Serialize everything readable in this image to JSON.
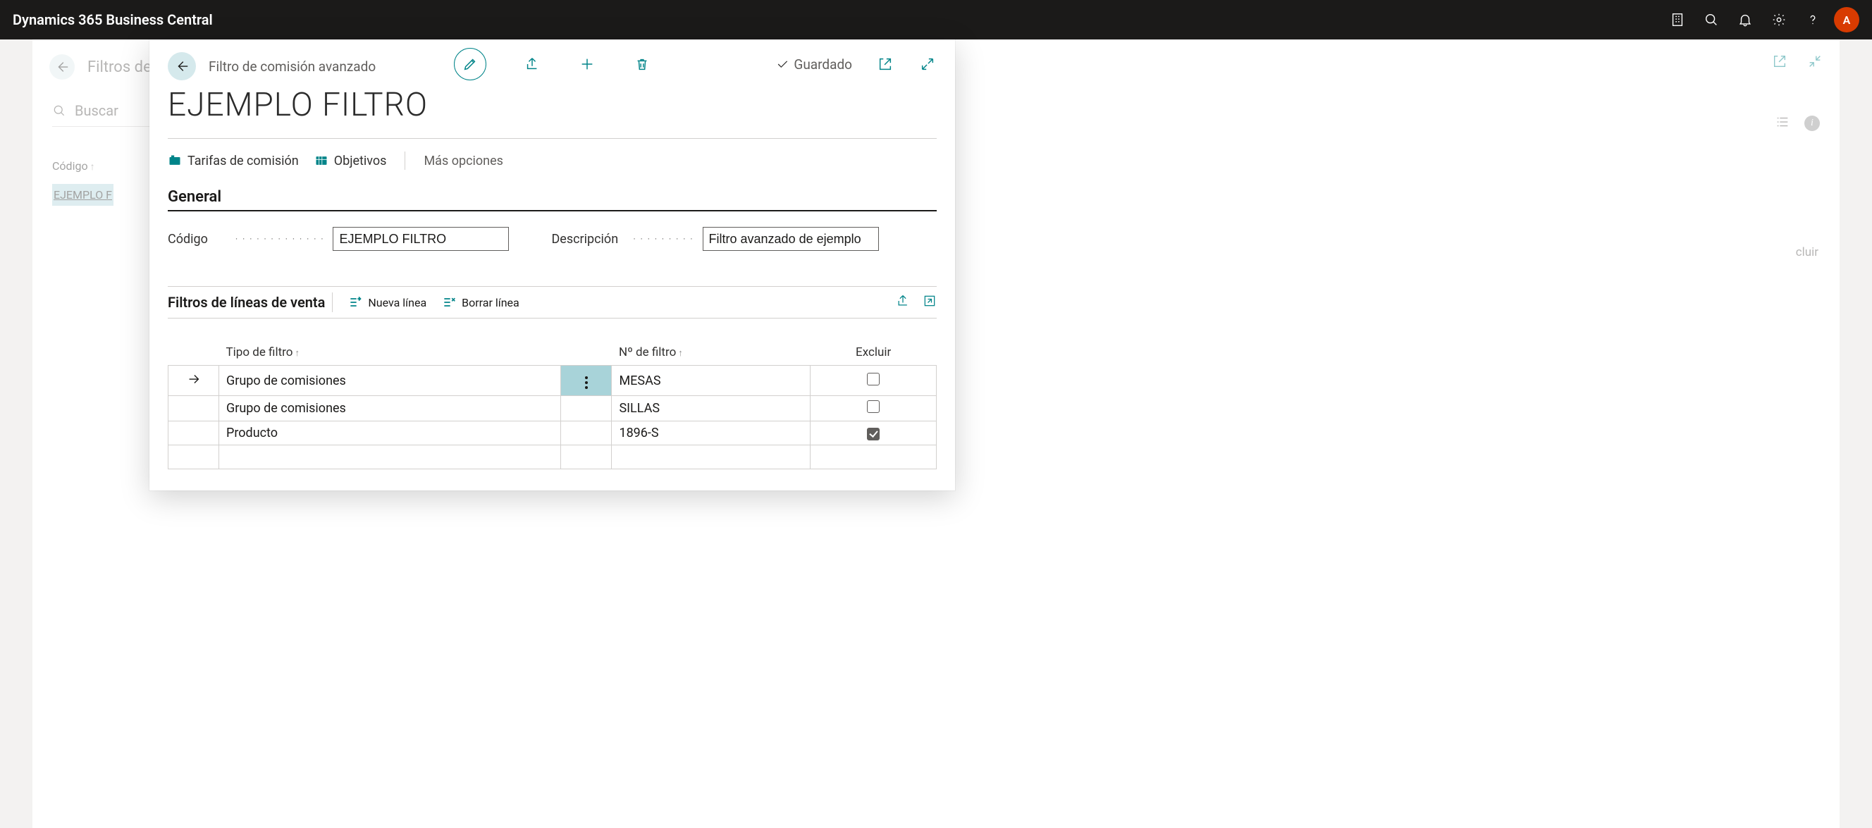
{
  "topbar": {
    "brand": "Dynamics 365 Business Central",
    "avatar_initial": "A"
  },
  "backpage": {
    "title": "Filtros de co",
    "search_placeholder": "Buscar",
    "column_header": "Código",
    "row_link": "EJEMPLO F",
    "right_label": "cluir"
  },
  "card": {
    "breadcrumb": "Filtro de comisión avanzado",
    "saved_label": "Guardado",
    "title": "EJEMPLO FILTRO",
    "tabs": {
      "tarifas": "Tarifas de comisión",
      "objetivos": "Objetivos",
      "more": "Más opciones"
    },
    "general_header": "General",
    "fields": {
      "codigo_label": "Código",
      "codigo_value": "EJEMPLO FILTRO",
      "descripcion_label": "Descripción",
      "descripcion_value": "Filtro avanzado de ejemplo"
    },
    "subpage": {
      "title": "Filtros de líneas de venta",
      "new_line": "Nueva línea",
      "delete_line": "Borrar línea"
    },
    "table": {
      "columns": {
        "tipo": "Tipo de filtro",
        "num": "Nº de filtro",
        "excluir": "Excluir"
      },
      "rows": [
        {
          "pointer": true,
          "menu_active": true,
          "tipo": "Grupo de comisiones",
          "num": "MESAS",
          "excluir": false
        },
        {
          "pointer": false,
          "menu_active": false,
          "tipo": "Grupo de comisiones",
          "num": "SILLAS",
          "excluir": false
        },
        {
          "pointer": false,
          "menu_active": false,
          "tipo": "Producto",
          "num": "1896-S",
          "excluir": true
        }
      ]
    }
  }
}
